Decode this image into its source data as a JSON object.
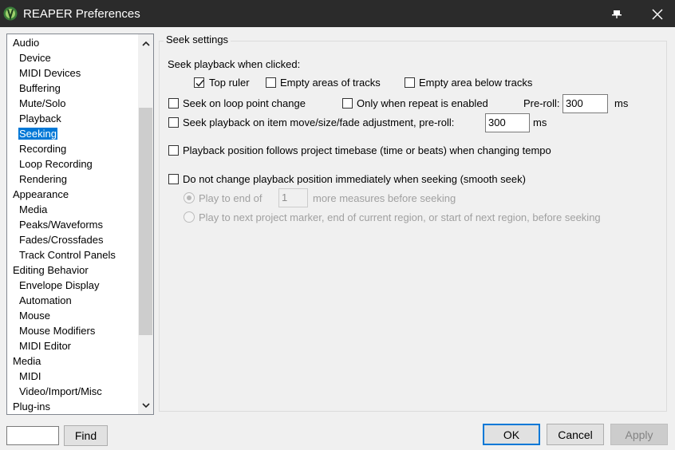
{
  "window": {
    "title": "REAPER Preferences"
  },
  "tree": {
    "items": [
      {
        "label": "Audio",
        "level": 0
      },
      {
        "label": "Device",
        "level": 1
      },
      {
        "label": "MIDI Devices",
        "level": 1
      },
      {
        "label": "Buffering",
        "level": 1
      },
      {
        "label": "Mute/Solo",
        "level": 1
      },
      {
        "label": "Playback",
        "level": 1
      },
      {
        "label": "Seeking",
        "level": 1,
        "selected": true
      },
      {
        "label": "Recording",
        "level": 1
      },
      {
        "label": "Loop Recording",
        "level": 1
      },
      {
        "label": "Rendering",
        "level": 1
      },
      {
        "label": "Appearance",
        "level": 0
      },
      {
        "label": "Media",
        "level": 1
      },
      {
        "label": "Peaks/Waveforms",
        "level": 1
      },
      {
        "label": "Fades/Crossfades",
        "level": 1
      },
      {
        "label": "Track Control Panels",
        "level": 1
      },
      {
        "label": "Editing Behavior",
        "level": 0
      },
      {
        "label": "Envelope Display",
        "level": 1
      },
      {
        "label": "Automation",
        "level": 1
      },
      {
        "label": "Mouse",
        "level": 1
      },
      {
        "label": "Mouse Modifiers",
        "level": 1
      },
      {
        "label": "MIDI Editor",
        "level": 1
      },
      {
        "label": "Media",
        "level": 0
      },
      {
        "label": "MIDI",
        "level": 1
      },
      {
        "label": "Video/Import/Misc",
        "level": 1
      },
      {
        "label": "Plug-ins",
        "level": 0
      }
    ]
  },
  "seek": {
    "group_title": "Seek settings",
    "clicked_label": "Seek playback when clicked:",
    "top_ruler": {
      "label": "Top ruler",
      "checked": true
    },
    "empty_tracks": {
      "label": "Empty areas of tracks",
      "checked": false
    },
    "empty_below": {
      "label": "Empty area below tracks",
      "checked": false
    },
    "loop_point": {
      "label": "Seek on loop point change",
      "checked": false
    },
    "only_repeat": {
      "label": "Only when repeat is enabled",
      "checked": false
    },
    "preroll_label": "Pre-roll:",
    "preroll_value": "300",
    "preroll_unit": "ms",
    "item_move": {
      "label": "Seek playback on item move/size/fade adjustment, pre-roll:",
      "checked": false
    },
    "item_preroll_value": "300",
    "item_preroll_unit": "ms",
    "timebase": {
      "label": "Playback position follows project timebase (time or beats) when changing tempo",
      "checked": false
    },
    "smooth": {
      "label": "Do not change playback position immediately when seeking (smooth seek)",
      "checked": false
    },
    "play_end_label": "Play to end of",
    "measures_value": "1",
    "measures_label": "more measures before seeking",
    "next_marker_label": "Play to next project marker, end of current region, or start of next region, before seeking"
  },
  "footer": {
    "find_value": "",
    "find_label": "Find",
    "ok_label": "OK",
    "cancel_label": "Cancel",
    "apply_label": "Apply"
  },
  "colors": {
    "titlebar": "#2b2b2b",
    "selection": "#0078d7",
    "window_bg": "#f0f0f0"
  }
}
